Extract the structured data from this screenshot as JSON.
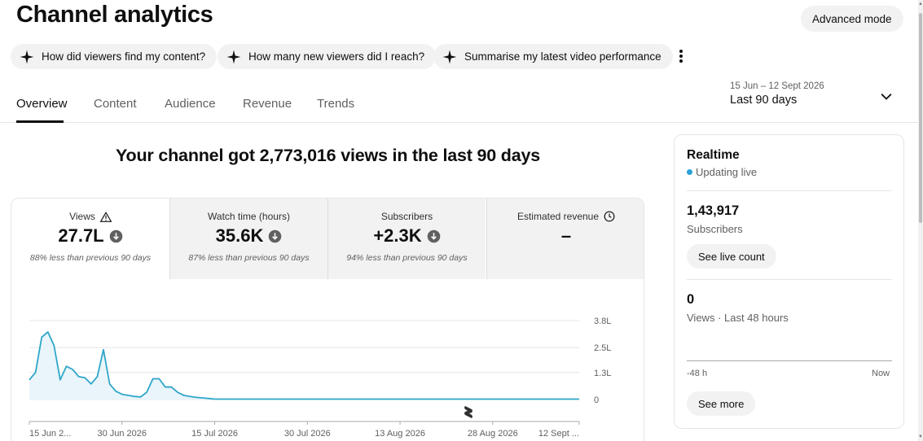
{
  "page": {
    "title": "Channel analytics",
    "advanced_mode": "Advanced mode"
  },
  "chips": [
    {
      "label": "How did viewers find my content?"
    },
    {
      "label": "How many new viewers did I reach?"
    },
    {
      "label": "Summarise my latest video performance"
    }
  ],
  "tabs": [
    {
      "label": "Overview",
      "active": true
    },
    {
      "label": "Content"
    },
    {
      "label": "Audience"
    },
    {
      "label": "Revenue"
    },
    {
      "label": "Trends"
    }
  ],
  "date_picker": {
    "range": "15 Jun – 12 Sept 2026",
    "label": "Last 90 days"
  },
  "headline": "Your channel got 2,773,016 views in the last 90 days",
  "metrics": [
    {
      "title": "Views",
      "value": "27.7L",
      "sub": "88% less than previous 90 days",
      "icon": "warning-icon",
      "trend_icon": "arrow-down-circle-icon"
    },
    {
      "title": "Watch time (hours)",
      "value": "35.6K",
      "sub": "87% less than previous 90 days",
      "trend_icon": "arrow-down-circle-icon"
    },
    {
      "title": "Subscribers",
      "value": "+2.3K",
      "sub": "94% less than previous 90 days",
      "trend_icon": "arrow-down-circle-icon"
    },
    {
      "title": "Estimated revenue",
      "value": "–",
      "sub": "",
      "icon": "clock-icon"
    }
  ],
  "chart_data": {
    "type": "area",
    "y_tick_labels": [
      "0",
      "1.3L",
      "2.5L",
      "3.8L"
    ],
    "y_tick_values": [
      0,
      1.3,
      2.5,
      3.8
    ],
    "ylim": [
      0,
      3.8
    ],
    "x_tick_labels": [
      "15 Jun 2...",
      "30 Jun 2026",
      "15 Jul 2026",
      "30 Jul 2026",
      "13 Aug 2026",
      "28 Aug 2026",
      "12 Sept ..."
    ],
    "x_tick_days": [
      0,
      15,
      30,
      45,
      60,
      75,
      89
    ],
    "series": [
      {
        "values": [
          0.95,
          1.3,
          3.0,
          3.25,
          2.6,
          0.95,
          1.6,
          1.45,
          1.1,
          1.05,
          0.75,
          1.1,
          2.4,
          0.75,
          0.4,
          0.25,
          0.2,
          0.15,
          0.12,
          0.35,
          1.0,
          1.0,
          0.6,
          0.6,
          0.35,
          0.2,
          0.15,
          0.1,
          0.08,
          0.05,
          0.02,
          0.02,
          0.02,
          0.02,
          0.02,
          0.02,
          0.02,
          0.02,
          0.02,
          0.02,
          0.02,
          0.02,
          0.02,
          0.02,
          0.02,
          0.02,
          0.02,
          0.02,
          0.02,
          0.02,
          0.02,
          0.02,
          0.02,
          0.02,
          0.02,
          0.02,
          0.02,
          0.02,
          0.02,
          0.02,
          0.02,
          0.02,
          0.02,
          0.02,
          0.02,
          0.02,
          0.02,
          0.02,
          0.02,
          0.02,
          0.02,
          0.02,
          0.02,
          0.02,
          0.02,
          0.02,
          0.02,
          0.02,
          0.02,
          0.02,
          0.02,
          0.02,
          0.02,
          0.02,
          0.02,
          0.02,
          0.02,
          0.02,
          0.02,
          0.02
        ],
        "color": "#2ea6c9"
      }
    ],
    "grid": true,
    "shorts_marker_icon": "shorts-icon"
  },
  "realtime": {
    "title": "Realtime",
    "status": "Updating live",
    "subscribers": "1,43,917",
    "subscribers_label": "Subscribers",
    "see_live_count": "See live count",
    "views": "0",
    "views_label": "Views · Last 48 hours",
    "axis_left": "-48 h",
    "axis_right": "Now",
    "see_more": "See more"
  },
  "colors": {
    "accent": "#2ea6c9",
    "chip_bg": "#f2f2f2",
    "live_dot": "#2aa1d8"
  }
}
